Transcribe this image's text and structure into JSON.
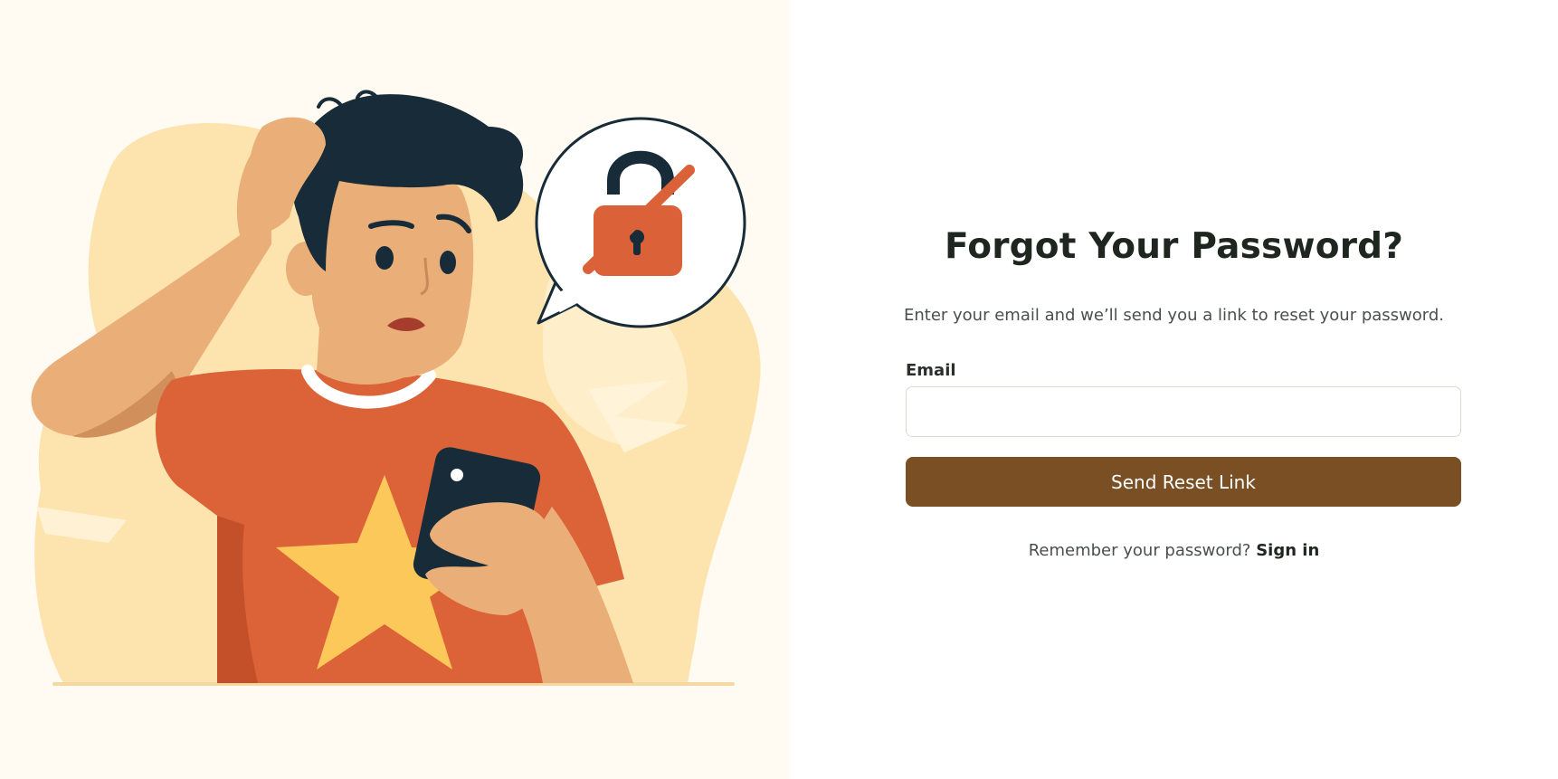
{
  "illustration": {
    "icon": "locked-out-person-illustration",
    "lock_icon": "lock-crossed-icon",
    "colors": {
      "background": "#fffbf2",
      "blob": "#fde4ae",
      "shirt": "#dc6338",
      "star": "#fdc85a",
      "skin": "#eaae78",
      "hair": "#172b38",
      "lock": "#db6138"
    }
  },
  "form": {
    "title": "Forgot Your Password?",
    "subtitle": "Enter your email and we’ll send you a link to reset your password.",
    "email_label": "Email",
    "email_value": "",
    "email_placeholder": "",
    "submit_label": "Send Reset Link",
    "footer_text": "Remember your password?",
    "signin_label": "Sign in",
    "colors": {
      "button": "#7a4f24",
      "title": "#1f2620"
    }
  }
}
